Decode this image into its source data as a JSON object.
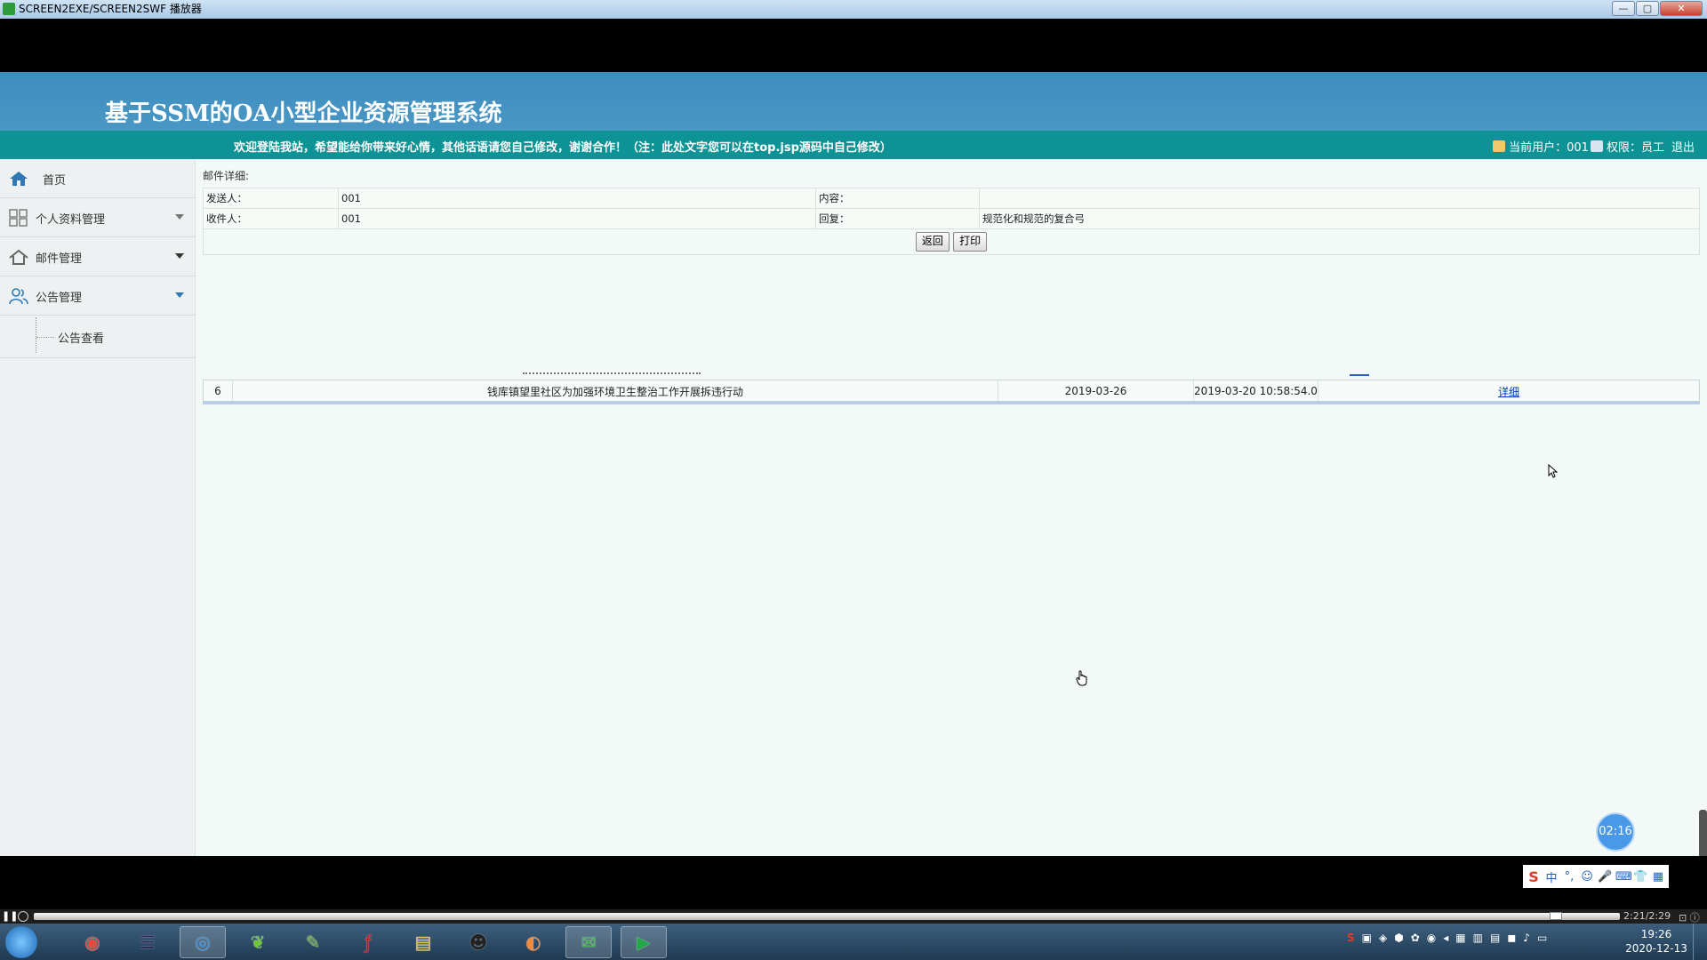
{
  "window": {
    "title": "SCREEN2EXE/SCREEN2SWF 播放器",
    "min_glyph": "—",
    "max_glyph": "▢",
    "close_glyph": "✕"
  },
  "header": {
    "system_title": "基于SSM的OA小型企业资源管理系统",
    "welcome": "欢迎登陆我站，希望能给你带来好心情，其他话语请您自己修改，谢谢合作！（注：此处文字您可以在top.jsp源码中自己修改）",
    "current_user_label": "当前用户：001",
    "role_label": "权限：员工",
    "logout": "退出"
  },
  "sidebar": {
    "home": "首页",
    "items": [
      {
        "label": "个人资料管理"
      },
      {
        "label": "邮件管理"
      },
      {
        "label": "公告管理"
      }
    ],
    "sub_item": "公告查看"
  },
  "mail_detail": {
    "section_label": "邮件详细:",
    "sender_label": "发送人：",
    "sender_value": "001",
    "content_label": "内容：",
    "content_value": "",
    "receiver_label": "收件人：",
    "receiver_value": "001",
    "reply_label": "回复：",
    "reply_value": "规范化和规范的复合弓",
    "back_button": "返回",
    "print_button": "打印"
  },
  "notice_row": {
    "index": "6",
    "title": "钱库镇望里社区为加强环境卫生整治工作开展拆违行动",
    "date": "2019-03-26",
    "created": "2019-03-20 10:58:54.0",
    "detail_link": "详细"
  },
  "player": {
    "timer_bubble": "02:16",
    "play_time": "2:21/2:29",
    "pause_glyph": "❚❚",
    "ctrl_glyphs": "⊡ ⓘ"
  },
  "ime": {
    "logo": "S",
    "items": [
      "中",
      "°,",
      "☺",
      "🎤",
      "⌨",
      "👕",
      "▦"
    ]
  },
  "taskbar": {
    "apps": [
      {
        "icon": "chrome-icon",
        "glyph": "◉",
        "color": "#e34c3c"
      },
      {
        "icon": "eclipse-icon",
        "glyph": "☰",
        "color": "#2c2a5c"
      },
      {
        "icon": "browser-icon",
        "glyph": "◎",
        "color": "#2d88d8"
      },
      {
        "icon": "tool-icon",
        "glyph": "❦",
        "color": "#6cc63a"
      },
      {
        "icon": "notepad-icon",
        "glyph": "✎",
        "color": "#6aa33c"
      },
      {
        "icon": "flash-icon",
        "glyph": "ƒ",
        "color": "#c4161c"
      },
      {
        "icon": "explorer-icon",
        "glyph": "▤",
        "color": "#e8c060"
      },
      {
        "icon": "qq-icon",
        "glyph": "☻",
        "color": "#222"
      },
      {
        "icon": "audio-icon",
        "glyph": "◐",
        "color": "#f08a3c"
      },
      {
        "icon": "wechat-icon",
        "glyph": "✉",
        "color": "#3bb34a"
      },
      {
        "icon": "screen2swf-icon",
        "glyph": "▶",
        "color": "#22a84a"
      }
    ],
    "tray_glyphs": [
      "S",
      "▣",
      "◈",
      "⬢",
      "✿",
      "◉",
      "◂",
      "▦",
      "▥",
      "▤",
      "◼",
      "♪",
      "▭"
    ],
    "time": "19:26",
    "date": "2020-12-13"
  }
}
